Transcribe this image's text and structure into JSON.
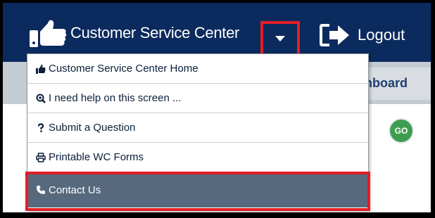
{
  "header": {
    "customer_service_label": "Customer Service Center",
    "logout_label": "Logout"
  },
  "dropdown": {
    "items": [
      {
        "label": "Customer Service Center Home",
        "icon": "thumbs-up-icon"
      },
      {
        "label": "I need help on this screen ...",
        "icon": "search-plus-icon"
      },
      {
        "label": "Submit a Question",
        "icon": "question-icon"
      },
      {
        "label": "Printable WC Forms",
        "icon": "print-icon"
      },
      {
        "label": "Contact Us",
        "icon": "phone-icon",
        "selected": true
      }
    ]
  },
  "background": {
    "dashboard_tab_label": "hboard",
    "go_button_label": "GO"
  },
  "colors": {
    "navbar": "#0b2a5e",
    "highlight_outline": "#e41e26",
    "active_item": "#57697d",
    "go_button": "#3f9d52"
  }
}
